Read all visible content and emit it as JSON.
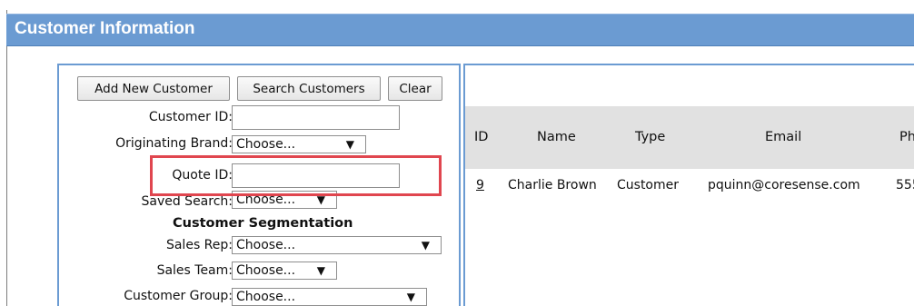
{
  "header": {
    "title": "Customer Information"
  },
  "buttons": {
    "add_new": "Add New Customer",
    "search": "Search Customers",
    "clear": "Clear"
  },
  "form": {
    "customer_id_label": "Customer ID:",
    "customer_id_value": "",
    "originating_brand_label": "Originating Brand:",
    "originating_brand_value": "Choose...",
    "quote_id_label": "Quote ID:",
    "quote_id_value": "",
    "saved_search_label": "Saved Search:",
    "saved_search_value": "Choose...",
    "segmentation_heading": "Customer Segmentation",
    "sales_rep_label": "Sales Rep:",
    "sales_rep_value": "Choose...",
    "sales_team_label": "Sales Team:",
    "sales_team_value": "Choose...",
    "customer_group_label": "Customer Group:",
    "customer_group_value": "Choose..."
  },
  "table": {
    "columns": [
      "ID",
      "Name",
      "Type",
      "Email",
      "Pho"
    ],
    "rows": [
      {
        "id": "9",
        "name": "Charlie Brown",
        "type": "Customer",
        "email": "pquinn@coresense.com",
        "phone": "555"
      }
    ]
  },
  "colors": {
    "header_bar": "#6b9bd2",
    "highlight_box": "#e0464f",
    "table_header_bg": "#e1e1e1"
  },
  "icons": {
    "dropdown": "triangle-down-icon"
  }
}
